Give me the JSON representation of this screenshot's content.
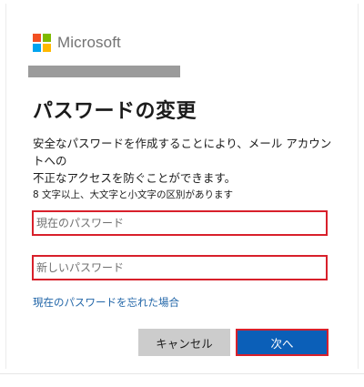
{
  "brand": {
    "name": "Microsoft",
    "logo_colors": [
      "#f25022",
      "#7fba00",
      "#00a4ef",
      "#ffb900"
    ]
  },
  "title": "パスワードの変更",
  "description_lines": [
    "安全なパスワードを作成することにより、メール アカウントへの",
    "不正なアクセスを防ぐことができます。"
  ],
  "password_rule": "8 文字以上、大文字と小文字の区別があります",
  "fields": {
    "current_password_placeholder": "現在のパスワード",
    "new_password_placeholder": "新しいパスワード"
  },
  "forgot_link": "現在のパスワードを忘れた場合",
  "buttons": {
    "cancel": "キャンセル",
    "next": "次へ"
  },
  "colors": {
    "accent": "#0b5fb8",
    "highlight": "#d8202b",
    "link": "#2266a8"
  }
}
